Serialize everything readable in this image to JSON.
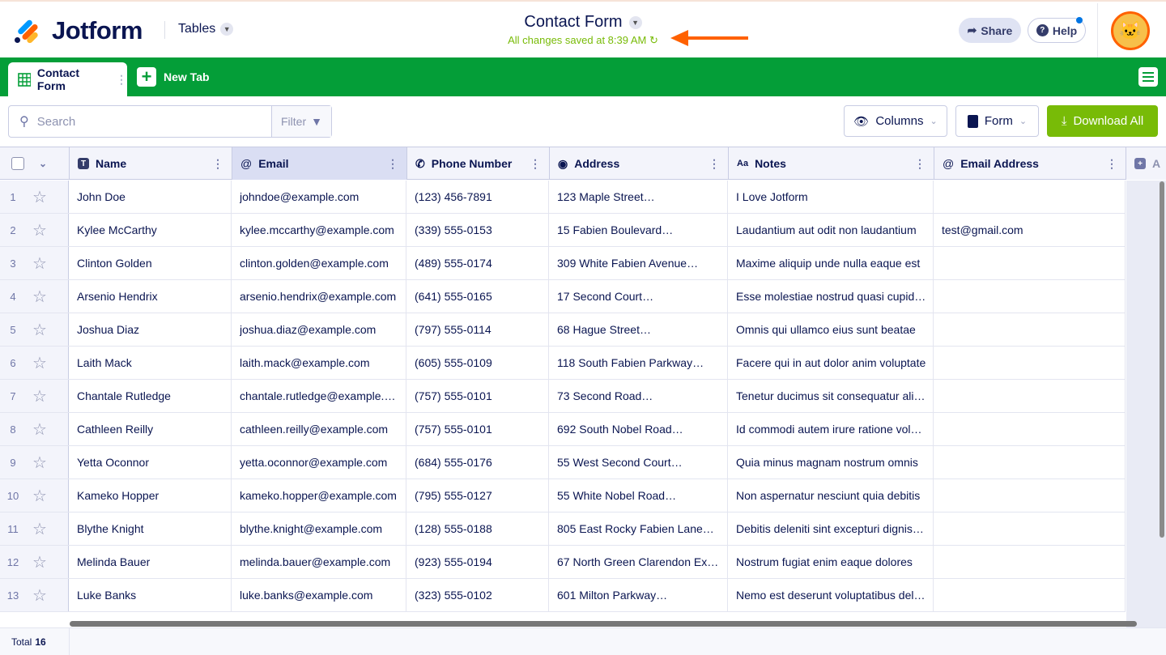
{
  "header": {
    "brand": "Jotform",
    "product": "Tables",
    "title": "Contact Form",
    "saved_status": "All changes saved at 8:39 AM",
    "share": "Share",
    "help": "Help"
  },
  "tabs": {
    "active": "Contact Form",
    "new_tab": "New Tab"
  },
  "toolbar": {
    "search_placeholder": "Search",
    "filter": "Filter",
    "columns": "Columns",
    "form": "Form",
    "download": "Download All"
  },
  "colors": {
    "green": "#049e38",
    "accent": "#78bb07",
    "arrow": "#ff6100"
  },
  "columns": [
    "Name",
    "Email",
    "Phone Number",
    "Address",
    "Notes",
    "Email Address",
    "A"
  ],
  "rows": [
    [
      "1",
      "John Doe",
      "johndoe@example.com",
      "(123) 456-7891",
      "123 Maple Street…",
      "I Love Jotform",
      ""
    ],
    [
      "2",
      "Kylee McCarthy",
      "kylee.mccarthy@example.com",
      "(339) 555-0153",
      "15 Fabien Boulevard…",
      "Laudantium aut odit non laudantium",
      "test@gmail.com"
    ],
    [
      "3",
      "Clinton Golden",
      "clinton.golden@example.com",
      "(489) 555-0174",
      "309 White Fabien Avenue…",
      "Maxime aliquip unde nulla eaque est",
      ""
    ],
    [
      "4",
      "Arsenio Hendrix",
      "arsenio.hendrix@example.com",
      "(641) 555-0165",
      "17 Second Court…",
      "Esse molestiae nostrud quasi cupiditate",
      ""
    ],
    [
      "5",
      "Joshua Diaz",
      "joshua.diaz@example.com",
      "(797) 555-0114",
      "68 Hague Street…",
      "Omnis qui ullamco eius sunt beatae",
      ""
    ],
    [
      "6",
      "Laith Mack",
      "laith.mack@example.com",
      "(605) 555-0109",
      "118 South Fabien Parkway…",
      "Facere qui in aut dolor anim voluptate",
      ""
    ],
    [
      "7",
      "Chantale Rutledge",
      "chantale.rutledge@example.com",
      "(757) 555-0101",
      "73 Second Road…",
      "Tenetur ducimus sit consequatur aliqua",
      ""
    ],
    [
      "8",
      "Cathleen Reilly",
      "cathleen.reilly@example.com",
      "(757) 555-0101",
      "692 South Nobel Road…",
      "Id commodi autem irure ratione voluptas",
      ""
    ],
    [
      "9",
      "Yetta Oconnor",
      "yetta.oconnor@example.com",
      "(684) 555-0176",
      "55 West Second Court…",
      "Quia minus magnam nostrum omnis",
      ""
    ],
    [
      "10",
      "Kameko Hopper",
      "kameko.hopper@example.com",
      "(795) 555-0127",
      "55 White Nobel Road…",
      "Non aspernatur nesciunt quia debitis",
      ""
    ],
    [
      "11",
      "Blythe Knight",
      "blythe.knight@example.com",
      "(128) 555-0188",
      "805 East Rocky Fabien Lane…",
      "Debitis deleniti sint excepturi dignissimos",
      ""
    ],
    [
      "12",
      "Melinda Bauer",
      "melinda.bauer@example.com",
      "(923) 555-0194",
      "67 North Green Clarendon Ex…",
      "Nostrum fugiat enim eaque dolores",
      ""
    ],
    [
      "13",
      "Luke Banks",
      "luke.banks@example.com",
      "(323) 555-0102",
      "601 Milton Parkway…",
      "Nemo est deserunt voluptatibus deleniti",
      ""
    ]
  ],
  "footer": {
    "total_label": "Total",
    "total_value": "16"
  }
}
